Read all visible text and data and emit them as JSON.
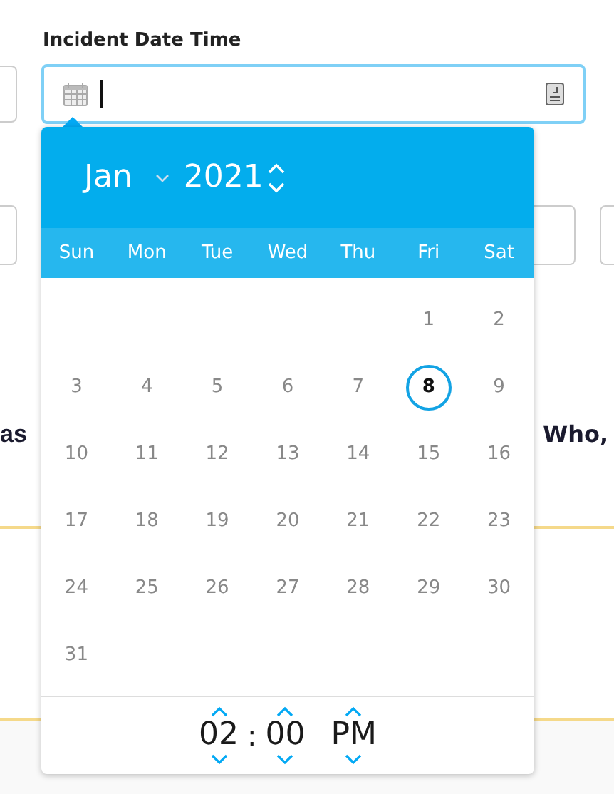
{
  "field_label": "Incident Date Time",
  "date_input": {
    "focused": true
  },
  "fragments": {
    "left": "as",
    "right": "Who,"
  },
  "picker": {
    "month": "Jan",
    "year": "2021",
    "weekdays": [
      "Sun",
      "Mon",
      "Tue",
      "Wed",
      "Thu",
      "Fri",
      "Sat"
    ],
    "weeks": [
      [
        {
          "day": "1",
          "selected": false
        },
        {
          "day": "2",
          "selected": false
        }
      ],
      [
        {
          "day": "3",
          "selected": false
        },
        {
          "day": "4",
          "selected": false
        },
        {
          "day": "5",
          "selected": false
        },
        {
          "day": "6",
          "selected": false
        },
        {
          "day": "7",
          "selected": false
        },
        {
          "day": "8",
          "selected": true
        },
        {
          "day": "9",
          "selected": false
        }
      ],
      [
        {
          "day": "10",
          "selected": false
        },
        {
          "day": "11",
          "selected": false
        },
        {
          "day": "12",
          "selected": false
        },
        {
          "day": "13",
          "selected": false
        },
        {
          "day": "14",
          "selected": false
        },
        {
          "day": "15",
          "selected": false
        },
        {
          "day": "16",
          "selected": false
        }
      ],
      [
        {
          "day": "17",
          "selected": false
        },
        {
          "day": "18",
          "selected": false
        },
        {
          "day": "19",
          "selected": false
        },
        {
          "day": "20",
          "selected": false
        },
        {
          "day": "21",
          "selected": false
        },
        {
          "day": "22",
          "selected": false
        },
        {
          "day": "23",
          "selected": false
        }
      ],
      [
        {
          "day": "24",
          "selected": false
        },
        {
          "day": "25",
          "selected": false
        },
        {
          "day": "26",
          "selected": false
        },
        {
          "day": "27",
          "selected": false
        },
        {
          "day": "28",
          "selected": false
        },
        {
          "day": "29",
          "selected": false
        },
        {
          "day": "30",
          "selected": false
        }
      ],
      [
        {
          "day": "31",
          "selected": false
        }
      ]
    ],
    "time": {
      "hour": "02",
      "separator": ":",
      "minute": "00",
      "period": "PM"
    }
  }
}
